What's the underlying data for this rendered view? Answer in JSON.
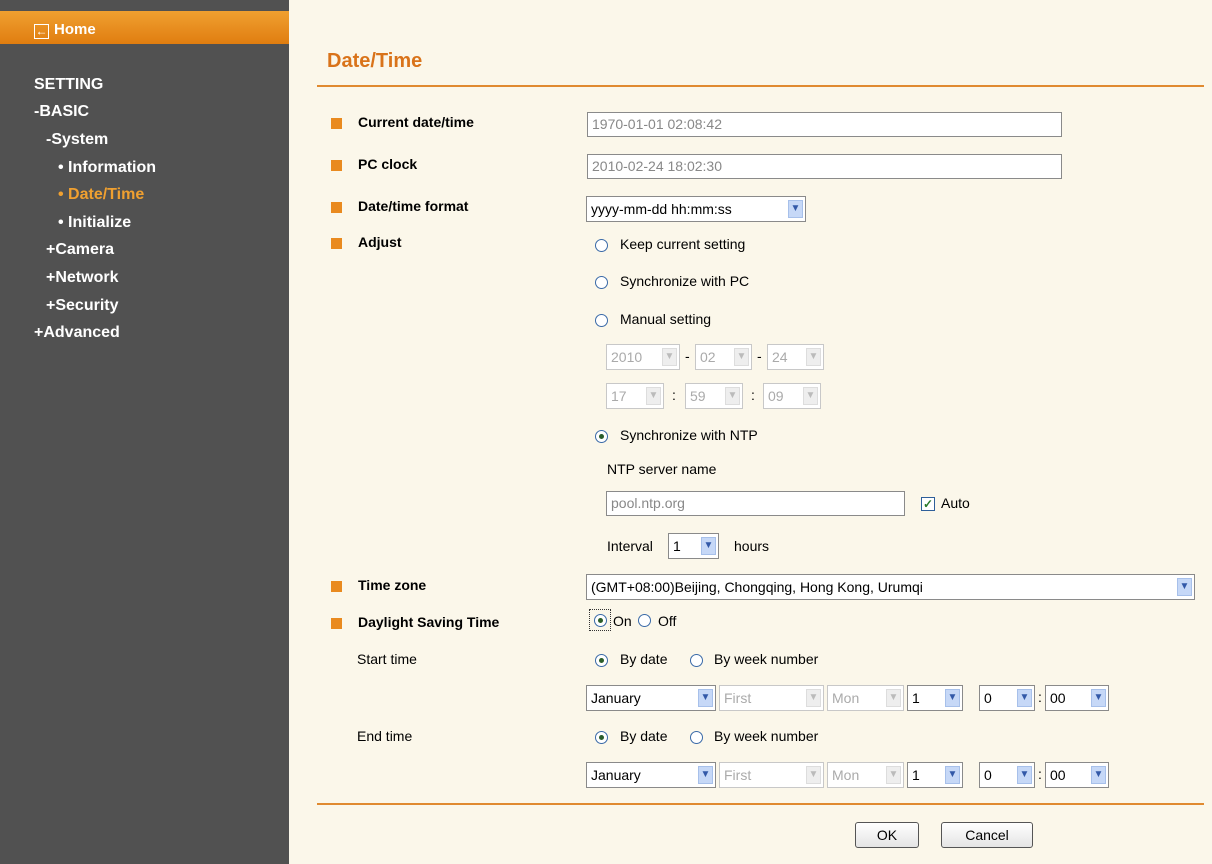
{
  "sidebar": {
    "home_label": "Home",
    "setting": "SETTING",
    "basic": "-BASIC",
    "system": "-System",
    "information": "• Information",
    "datetime": "• Date/Time",
    "initialize": "• Initialize",
    "camera": "+Camera",
    "network": "+Network",
    "security": "+Security",
    "advanced": "+Advanced"
  },
  "page": {
    "title": "Date/Time",
    "current_label": "Current date/time",
    "current_value": "1970-01-01   02:08:42",
    "pc_label": "PC clock",
    "pc_value": "2010-02-24   18:02:30",
    "format_label": "Date/time format",
    "format_value": "yyyy-mm-dd hh:mm:ss",
    "adjust_label": "Adjust",
    "opt_keep": "Keep current setting",
    "opt_sync_pc": "Synchronize with PC",
    "opt_manual": "Manual setting",
    "manual_year": "2010",
    "manual_month": "02",
    "manual_day": "24",
    "manual_hour": "17",
    "manual_minute": "59",
    "manual_second": "09",
    "date_sep": "-",
    "time_sep": ":",
    "opt_ntp": "Synchronize with NTP",
    "ntp_server_label": "NTP server name",
    "ntp_server_value": "pool.ntp.org",
    "auto_label": "Auto",
    "interval_label": "Interval",
    "interval_value": "1",
    "interval_unit": "hours",
    "tz_label": "Time zone",
    "tz_value": "(GMT+08:00)Beijing, Chongqing, Hong Kong, Urumqi",
    "dst_label": "Daylight Saving Time",
    "dst_on": "On",
    "dst_off": "Off",
    "start_label": "Start time",
    "end_label": "End time",
    "by_date": "By date",
    "by_week": "By week number",
    "start": {
      "month": "January",
      "week": "First",
      "weekday": "Mon",
      "day": "1",
      "hour": "0",
      "minute": "00"
    },
    "end": {
      "month": "January",
      "week": "First",
      "weekday": "Mon",
      "day": "1",
      "hour": "0",
      "minute": "00"
    },
    "ok": "OK",
    "cancel": "Cancel"
  },
  "colors": {
    "accent": "#e08a30",
    "sidebar_bg": "#515151",
    "page_bg": "#fbf7ea",
    "title": "#d9731a"
  }
}
